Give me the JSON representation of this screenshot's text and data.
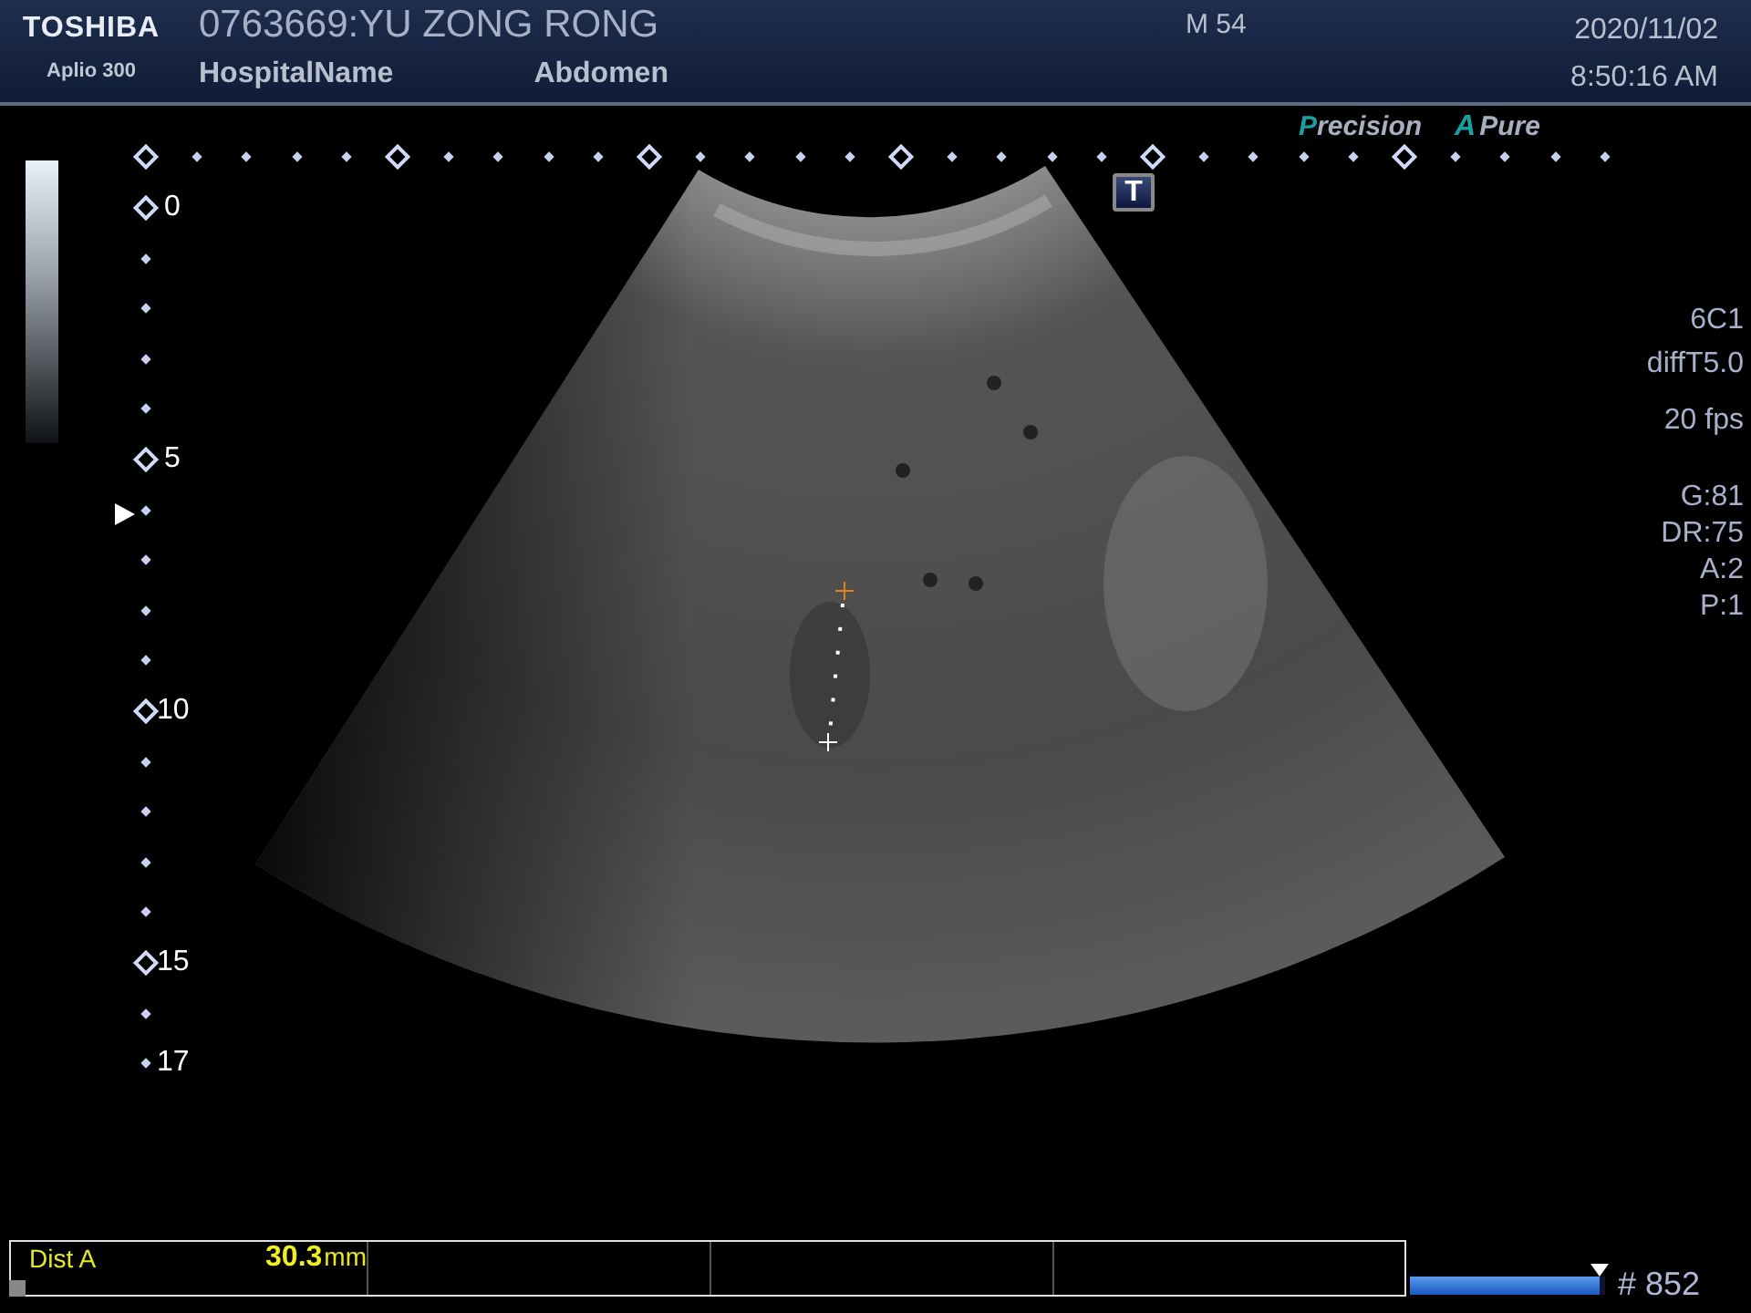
{
  "header": {
    "brand": "TOSHIBA",
    "model": "Aplio 300",
    "patient": "0763669:YU ZONG RONG",
    "hospital": "HospitalName",
    "exam": "Abdomen",
    "sex_age": "M 54",
    "date": "2020/11/02",
    "time": "8:50:16 AM"
  },
  "logos": {
    "precision": "Precision",
    "apure_mark": "A",
    "apure": "Pure"
  },
  "t_button": "T",
  "depth_labels": [
    "0",
    "5",
    "10",
    "15",
    "17"
  ],
  "probe": [
    "6C1",
    "diffT5.0"
  ],
  "frame_rate": "20 fps",
  "settings": [
    "G:81",
    "DR:75",
    "A:2",
    "P:1"
  ],
  "measurement": {
    "label": "Dist A",
    "value": "30.3",
    "unit": "mm"
  },
  "cine": {
    "level": 0.97,
    "frame": "# 852"
  }
}
